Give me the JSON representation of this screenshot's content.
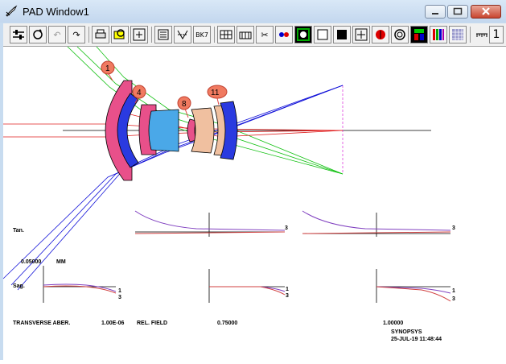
{
  "window": {
    "title": "PAD Window1"
  },
  "toolbar": {
    "items": [
      "sliders",
      "rotate",
      "undo",
      "redo-one",
      "print",
      "zoom-lens",
      "fit",
      "scroll",
      "aberration",
      "bk7",
      "table",
      "glass",
      "scissors",
      "dots",
      "camera",
      "white-square",
      "black-square",
      "move",
      "red-dot",
      "ring",
      "color-bars",
      "stripes",
      "mesh",
      "ruler"
    ],
    "overflow_label": "1"
  },
  "surfaces": [
    "1",
    "4",
    "8",
    "11"
  ],
  "plot": {
    "tan_label": "Tan.",
    "sag_label": "Sag.",
    "scale_value": "0.05000",
    "scale_unit": "MM",
    "curve_label_1": "1",
    "curve_label_3": "3",
    "footer": {
      "transverse": "TRANSVERSE ABER.",
      "wavelength": "1.00E-06",
      "rel_field": "REL. FIELD",
      "field_mid": "0.75000",
      "field_full": "1.00000"
    },
    "stamp": {
      "vendor": "SYNOPSYS",
      "date": "25-JUL-19 11:48:44"
    }
  }
}
